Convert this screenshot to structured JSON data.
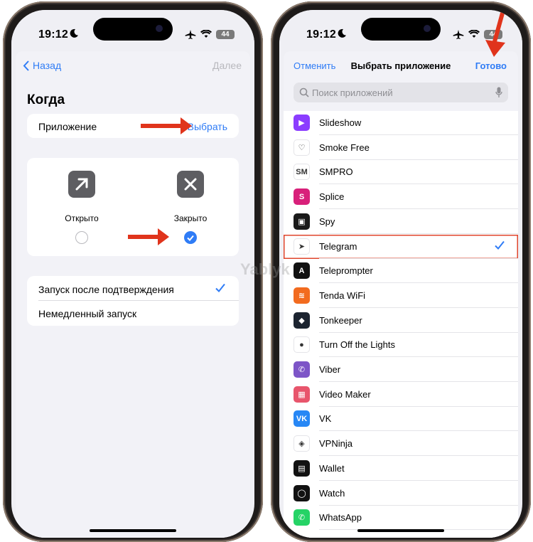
{
  "left_phone": {
    "status": {
      "time": "19:12",
      "battery": "44"
    },
    "nav": {
      "back_label": "Назад",
      "next_label": "Далее"
    },
    "section_title": "Когда",
    "app_row": {
      "label": "Приложение",
      "action": "Выбрать"
    },
    "options": [
      {
        "label": "Открыто",
        "icon": "arrow-up-right-icon",
        "selected": false
      },
      {
        "label": "Закрыто",
        "icon": "close-x-icon",
        "selected": true
      }
    ],
    "launch_modes": [
      {
        "label": "Запуск после подтверждения",
        "checked": true
      },
      {
        "label": "Немедленный запуск",
        "checked": false
      }
    ]
  },
  "right_phone": {
    "status": {
      "time": "19:12",
      "battery": "44"
    },
    "header": {
      "cancel_label": "Отменить",
      "title": "Выбрать приложение",
      "done_label": "Готово"
    },
    "search": {
      "placeholder": "Поиск приложений"
    },
    "apps": [
      {
        "name": "Slideshow",
        "color": "#8b3dff",
        "glyph": "▶"
      },
      {
        "name": "Smoke Free",
        "color": "#ffffff",
        "glyph": "♡"
      },
      {
        "name": "SMPRO",
        "color": "#ffffff",
        "glyph": "SM"
      },
      {
        "name": "Splice",
        "color": "#d8207a",
        "glyph": "S"
      },
      {
        "name": "Spy",
        "color": "#1a1a1a",
        "glyph": "▣"
      },
      {
        "name": "Telegram",
        "color": "#ffffff",
        "glyph": "➤",
        "selected": true
      },
      {
        "name": "Teleprompter",
        "color": "#111111",
        "glyph": "A"
      },
      {
        "name": "Tenda WiFi",
        "color": "#f26b1f",
        "glyph": "≋"
      },
      {
        "name": "Tonkeeper",
        "color": "#1c2430",
        "glyph": "◆"
      },
      {
        "name": "Turn Off the Lights",
        "color": "#ffffff",
        "glyph": "●"
      },
      {
        "name": "Viber",
        "color": "#7d55c7",
        "glyph": "✆"
      },
      {
        "name": "Video Maker",
        "color": "#e8556c",
        "glyph": "▦"
      },
      {
        "name": "VK",
        "color": "#2787f5",
        "glyph": "VK"
      },
      {
        "name": "VPNinja",
        "color": "#ffffff",
        "glyph": "◈"
      },
      {
        "name": "Wallet",
        "color": "#111111",
        "glyph": "▤"
      },
      {
        "name": "Watch",
        "color": "#111111",
        "glyph": "◯"
      },
      {
        "name": "WhatsApp",
        "color": "#25d366",
        "glyph": "✆"
      }
    ]
  },
  "watermark": "Yablyk",
  "colors": {
    "accent": "#2f7cf6",
    "arrow": "#e0341c",
    "highlight": "#e0462c"
  }
}
